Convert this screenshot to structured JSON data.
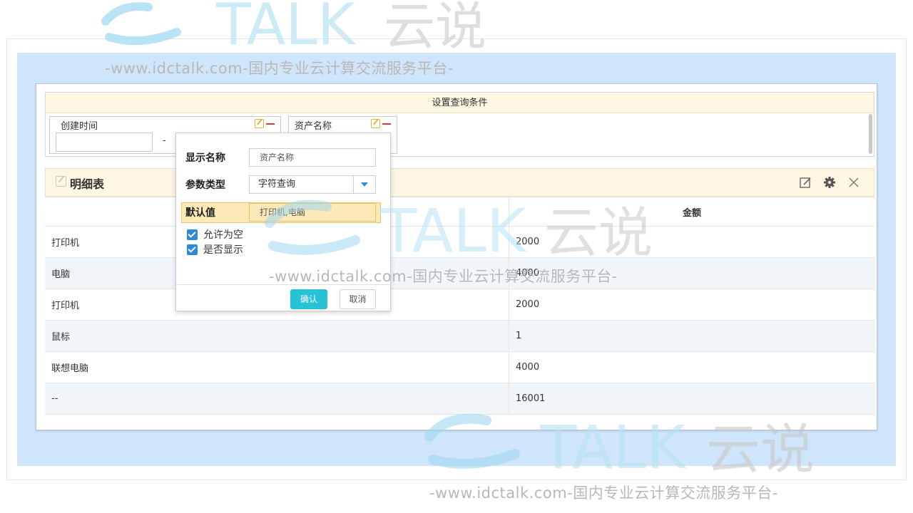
{
  "query": {
    "title": "设置查询条件",
    "fields": [
      {
        "label": "创建时间"
      },
      {
        "label": "资产名称"
      }
    ],
    "range_separator": "-"
  },
  "detail": {
    "title": "明细表",
    "columns": [
      "",
      "金额"
    ],
    "rows": [
      {
        "name": "打印机",
        "amount": "2000"
      },
      {
        "name": "电脑",
        "amount": "4000"
      },
      {
        "name": "打印机",
        "amount": "2000"
      },
      {
        "name": "鼠标",
        "amount": "1"
      },
      {
        "name": "联想电脑",
        "amount": "4000"
      },
      {
        "name": "--",
        "amount": "16001"
      }
    ]
  },
  "popup": {
    "display_name_label": "显示名称",
    "display_name_value": "资产名称",
    "param_type_label": "参数类型",
    "param_type_value": "字符查询",
    "default_label": "默认值",
    "default_value": "打印机,电脑",
    "allow_empty_label": "允许为空",
    "show_label": "是否显示",
    "ok_label": "确认",
    "cancel_label": "取消"
  },
  "watermark": {
    "brand": "TALK 云说",
    "text": "-www.idctalk.com-国内专业云计算交流服务平台-"
  },
  "colors": {
    "accent": "#2d8ad8",
    "ok_button": "#27c2d6",
    "header_bg": "#fdf6e3",
    "page_bg": "#cfe5fb",
    "highlight": "#fde9b8"
  }
}
